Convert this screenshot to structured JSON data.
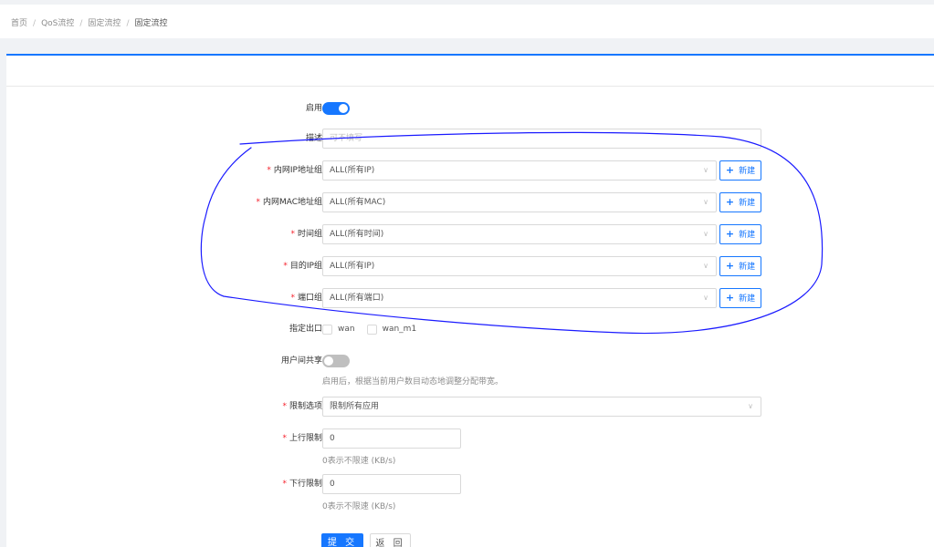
{
  "breadcrumb": [
    "首页",
    "QoS流控",
    "固定流控",
    "固定流控"
  ],
  "form": {
    "enable": {
      "label": "启用",
      "on": true
    },
    "description": {
      "label": "描述",
      "placeholder": "可不填写"
    },
    "selects": [
      {
        "label": "内网IP地址组",
        "value": "ALL(所有IP)",
        "required": true
      },
      {
        "label": "内网MAC地址组",
        "value": "ALL(所有MAC)",
        "required": true
      },
      {
        "label": "时间组",
        "value": "ALL(所有时间)",
        "required": true
      },
      {
        "label": "目的IP组",
        "value": "ALL(所有IP)",
        "required": true
      },
      {
        "label": "端口组",
        "value": "ALL(所有端口)",
        "required": true
      }
    ],
    "new_button_label": "新建",
    "outlet": {
      "label": "指定出口",
      "options": [
        "wan",
        "wan_m1"
      ]
    },
    "share": {
      "label": "用户间共享",
      "on": false,
      "help": "启用后，根据当前用户数目动态地调整分配带宽。"
    },
    "limit_option": {
      "label": "限制选项",
      "value": "限制所有应用"
    },
    "upload_limit": {
      "label": "上行限制",
      "value": "0",
      "help": "0表示不限速 (KB/s)"
    },
    "download_limit": {
      "label": "下行限制",
      "value": "0",
      "help": "0表示不限速 (KB/s)"
    }
  },
  "buttons": {
    "submit": "提 交",
    "back": "返 回"
  },
  "colors": {
    "accent": "#1677ff",
    "required": "#f5222d",
    "annotation": "#1a1aff"
  }
}
